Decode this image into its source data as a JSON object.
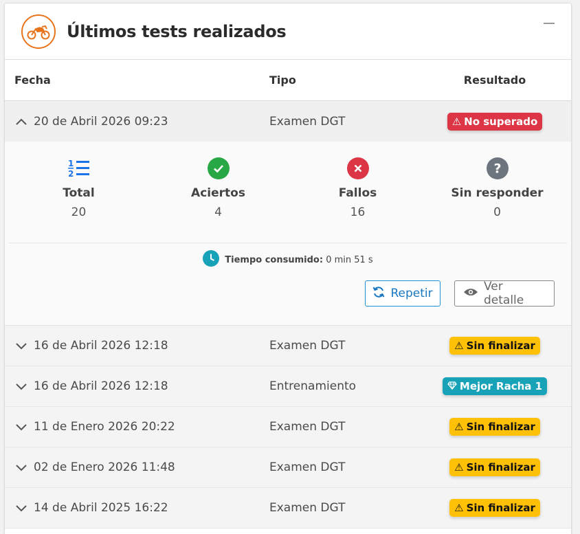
{
  "card": {
    "title": "Últimos tests realizados",
    "icon": "motorcycle-icon",
    "accent_color": "#e8741c"
  },
  "table": {
    "headers": {
      "fecha": "Fecha",
      "tipo": "Tipo",
      "resultado": "Resultado"
    },
    "rows": [
      {
        "fecha": "20 de Abril 2026 09:23",
        "tipo": "Examen DGT",
        "resultado": "No superado",
        "badge": "red",
        "badge_icon": "warning-icon",
        "expanded": true
      },
      {
        "fecha": "16 de Abril 2026 12:18",
        "tipo": "Examen DGT",
        "resultado": "Sin finalizar",
        "badge": "yellow",
        "badge_icon": "warning-icon",
        "expanded": false
      },
      {
        "fecha": "16 de Abril 2026 12:18",
        "tipo": "Entrenamiento",
        "resultado": "Mejor Racha 1",
        "badge": "teal",
        "badge_icon": "diamond-icon",
        "expanded": false
      },
      {
        "fecha": "11 de Enero 2026 20:22",
        "tipo": "Examen DGT",
        "resultado": "Sin finalizar",
        "badge": "yellow",
        "badge_icon": "warning-icon",
        "expanded": false
      },
      {
        "fecha": "02 de Enero 2026 11:48",
        "tipo": "Examen DGT",
        "resultado": "Sin finalizar",
        "badge": "yellow",
        "badge_icon": "warning-icon",
        "expanded": false
      },
      {
        "fecha": "14 de Abril 2025 16:22",
        "tipo": "Examen DGT",
        "resultado": "Sin finalizar",
        "badge": "yellow",
        "badge_icon": "warning-icon",
        "expanded": false
      }
    ]
  },
  "detail": {
    "stats": [
      {
        "label": "Total",
        "value": "20",
        "icon": "list-numbered-icon",
        "color": "#1a73e8"
      },
      {
        "label": "Aciertos",
        "value": "4",
        "icon": "check-circle-icon",
        "color": "#28a745"
      },
      {
        "label": "Fallos",
        "value": "16",
        "icon": "x-circle-icon",
        "color": "#dc3545"
      },
      {
        "label": "Sin responder",
        "value": "0",
        "icon": "question-circle-icon",
        "color": "#6c757d"
      }
    ],
    "time_label": "Tiempo consumido:",
    "time_value": "0 min 51 s",
    "repeat_button": "Repetir",
    "detail_button": "Ver detalle"
  },
  "colors": {
    "red": "#dc3545",
    "yellow": "#ffc107",
    "teal": "#17a2b8",
    "blue": "#1a78c2"
  }
}
